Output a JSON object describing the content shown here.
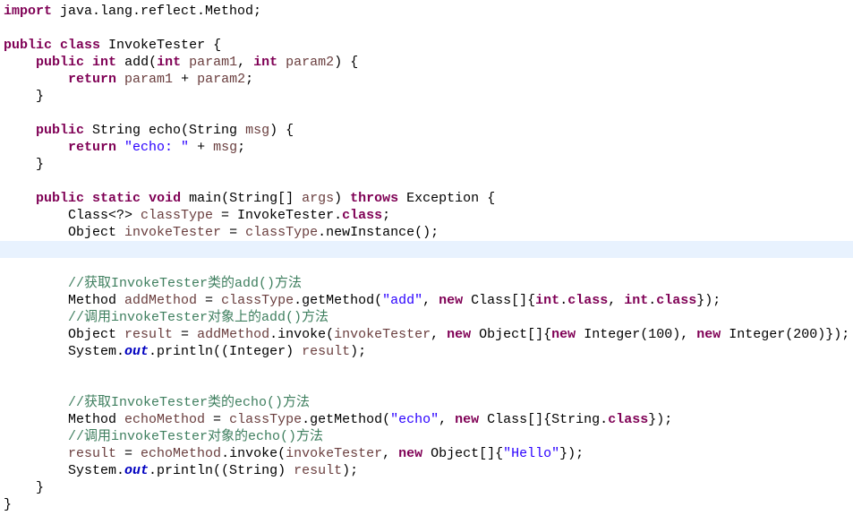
{
  "editor": {
    "current_line": 15,
    "colors": {
      "keyword": "#7f0055",
      "string": "#2a00ff",
      "comment": "#3f7f5f",
      "local_variable": "#6a3e3e",
      "static_field": "#0000c0",
      "current_line_bg": "#e8f2fe"
    },
    "lines": [
      [
        [
          "k",
          "import"
        ],
        [
          "p",
          " java.lang.reflect.Method;"
        ]
      ],
      [],
      [
        [
          "k",
          "public"
        ],
        [
          "p",
          " "
        ],
        [
          "k",
          "class"
        ],
        [
          "p",
          " InvokeTester {"
        ]
      ],
      [
        [
          "p",
          "    "
        ],
        [
          "k",
          "public"
        ],
        [
          "p",
          " "
        ],
        [
          "k",
          "int"
        ],
        [
          "p",
          " add("
        ],
        [
          "k",
          "int"
        ],
        [
          "p",
          " "
        ],
        [
          "v",
          "param1"
        ],
        [
          "p",
          ", "
        ],
        [
          "k",
          "int"
        ],
        [
          "p",
          " "
        ],
        [
          "v",
          "param2"
        ],
        [
          "p",
          ") {"
        ]
      ],
      [
        [
          "p",
          "        "
        ],
        [
          "k",
          "return"
        ],
        [
          "p",
          " "
        ],
        [
          "v",
          "param1"
        ],
        [
          "p",
          " + "
        ],
        [
          "v",
          "param2"
        ],
        [
          "p",
          ";"
        ]
      ],
      [
        [
          "p",
          "    }"
        ]
      ],
      [],
      [
        [
          "p",
          "    "
        ],
        [
          "k",
          "public"
        ],
        [
          "p",
          " String echo(String "
        ],
        [
          "v",
          "msg"
        ],
        [
          "p",
          ") {"
        ]
      ],
      [
        [
          "p",
          "        "
        ],
        [
          "k",
          "return"
        ],
        [
          "p",
          " "
        ],
        [
          "s",
          "\"echo: \""
        ],
        [
          "p",
          " + "
        ],
        [
          "v",
          "msg"
        ],
        [
          "p",
          ";"
        ]
      ],
      [
        [
          "p",
          "    }"
        ]
      ],
      [],
      [
        [
          "p",
          "    "
        ],
        [
          "k",
          "public"
        ],
        [
          "p",
          " "
        ],
        [
          "k",
          "static"
        ],
        [
          "p",
          " "
        ],
        [
          "k",
          "void"
        ],
        [
          "p",
          " main(String[] "
        ],
        [
          "v",
          "args"
        ],
        [
          "p",
          ") "
        ],
        [
          "k",
          "throws"
        ],
        [
          "p",
          " Exception {"
        ]
      ],
      [
        [
          "p",
          "        Class<?> "
        ],
        [
          "v",
          "classType"
        ],
        [
          "p",
          " = InvokeTester."
        ],
        [
          "k",
          "class"
        ],
        [
          "p",
          ";"
        ]
      ],
      [
        [
          "p",
          "        Object "
        ],
        [
          "v",
          "invokeTester"
        ],
        [
          "p",
          " = "
        ],
        [
          "v",
          "classType"
        ],
        [
          "p",
          ".newInstance();"
        ]
      ],
      [],
      [],
      [
        [
          "p",
          "        "
        ],
        [
          "c",
          "//获取InvokeTester类的add()方法"
        ]
      ],
      [
        [
          "p",
          "        Method "
        ],
        [
          "v",
          "addMethod"
        ],
        [
          "p",
          " = "
        ],
        [
          "v",
          "classType"
        ],
        [
          "p",
          ".getMethod("
        ],
        [
          "s",
          "\"add\""
        ],
        [
          "p",
          ", "
        ],
        [
          "k",
          "new"
        ],
        [
          "p",
          " Class[]{"
        ],
        [
          "k",
          "int"
        ],
        [
          "p",
          "."
        ],
        [
          "k",
          "class"
        ],
        [
          "p",
          ", "
        ],
        [
          "k",
          "int"
        ],
        [
          "p",
          "."
        ],
        [
          "k",
          "class"
        ],
        [
          "p",
          "});"
        ]
      ],
      [
        [
          "p",
          "        "
        ],
        [
          "c",
          "//调用invokeTester对象上的add()方法"
        ]
      ],
      [
        [
          "p",
          "        Object "
        ],
        [
          "v",
          "result"
        ],
        [
          "p",
          " = "
        ],
        [
          "v",
          "addMethod"
        ],
        [
          "p",
          ".invoke("
        ],
        [
          "v",
          "invokeTester"
        ],
        [
          "p",
          ", "
        ],
        [
          "k",
          "new"
        ],
        [
          "p",
          " Object[]{"
        ],
        [
          "k",
          "new"
        ],
        [
          "p",
          " Integer(100), "
        ],
        [
          "k",
          "new"
        ],
        [
          "p",
          " Integer(200)});"
        ]
      ],
      [
        [
          "p",
          "        System."
        ],
        [
          "f",
          "out"
        ],
        [
          "p",
          ".println((Integer) "
        ],
        [
          "v",
          "result"
        ],
        [
          "p",
          ");"
        ]
      ],
      [],
      [],
      [
        [
          "p",
          "        "
        ],
        [
          "c",
          "//获取InvokeTester类的echo()方法"
        ]
      ],
      [
        [
          "p",
          "        Method "
        ],
        [
          "v",
          "echoMethod"
        ],
        [
          "p",
          " = "
        ],
        [
          "v",
          "classType"
        ],
        [
          "p",
          ".getMethod("
        ],
        [
          "s",
          "\"echo\""
        ],
        [
          "p",
          ", "
        ],
        [
          "k",
          "new"
        ],
        [
          "p",
          " Class[]{String."
        ],
        [
          "k",
          "class"
        ],
        [
          "p",
          "});"
        ]
      ],
      [
        [
          "p",
          "        "
        ],
        [
          "c",
          "//调用invokeTester对象的echo()方法"
        ]
      ],
      [
        [
          "p",
          "        "
        ],
        [
          "v",
          "result"
        ],
        [
          "p",
          " = "
        ],
        [
          "v",
          "echoMethod"
        ],
        [
          "p",
          ".invoke("
        ],
        [
          "v",
          "invokeTester"
        ],
        [
          "p",
          ", "
        ],
        [
          "k",
          "new"
        ],
        [
          "p",
          " Object[]{"
        ],
        [
          "s",
          "\"Hello\""
        ],
        [
          "p",
          "});"
        ]
      ],
      [
        [
          "p",
          "        System."
        ],
        [
          "f",
          "out"
        ],
        [
          "p",
          ".println((String) "
        ],
        [
          "v",
          "result"
        ],
        [
          "p",
          ");"
        ]
      ],
      [
        [
          "p",
          "    }"
        ]
      ],
      [
        [
          "p",
          "}"
        ]
      ]
    ]
  }
}
